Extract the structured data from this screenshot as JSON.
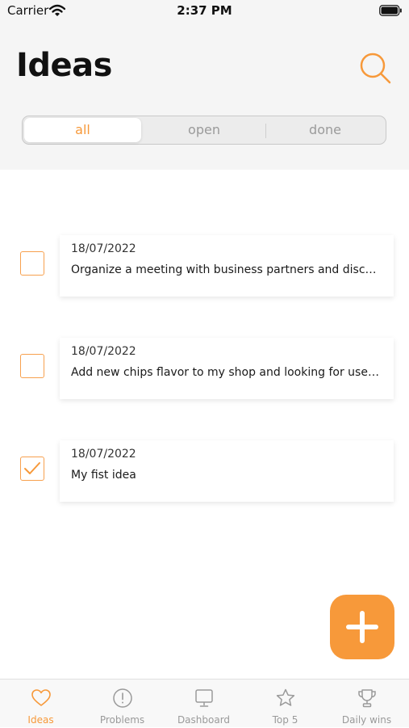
{
  "status_bar": {
    "carrier": "Carrier",
    "time": "2:37 PM"
  },
  "header": {
    "title": "Ideas",
    "search_icon": "search-icon"
  },
  "segmented": {
    "options": [
      "all",
      "open",
      "done"
    ],
    "selected": "all"
  },
  "ideas": [
    {
      "date": "18/07/2022",
      "text": "Organize a meeting with business partners and discuss…",
      "checked": false
    },
    {
      "date": "18/07/2022",
      "text": "Add new chips flavor to my shop and looking for users f…",
      "checked": false
    },
    {
      "date": "18/07/2022",
      "text": "My fist idea",
      "checked": true
    }
  ],
  "fab": {
    "icon": "plus-icon"
  },
  "tabs": [
    {
      "label": "Ideas",
      "icon": "heart-icon",
      "active": true
    },
    {
      "label": "Problems",
      "icon": "alert-circle-icon",
      "active": false
    },
    {
      "label": "Dashboard",
      "icon": "monitor-icon",
      "active": false
    },
    {
      "label": "Top 5",
      "icon": "star-icon",
      "active": false
    },
    {
      "label": "Daily wins",
      "icon": "trophy-icon",
      "active": false
    }
  ],
  "colors": {
    "accent": "#f7993a",
    "inactive": "#9a9a9a",
    "header_bg": "#f5f5f5"
  }
}
